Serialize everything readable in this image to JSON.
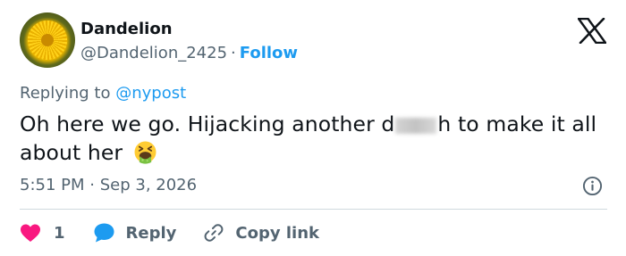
{
  "author": {
    "name": "Dandelion",
    "handle": "@Dandelion_2425",
    "separator": "·",
    "follow_label": "Follow",
    "avatar_icon": "dandelion-flower-avatar"
  },
  "platform_icon": "x-logo-icon",
  "reply": {
    "prefix": "Replying to",
    "mention": "@nypost"
  },
  "tweet": {
    "text_before": "Oh here we go. Hijacking another d",
    "text_after": "h to make it all about her",
    "censored_icon": "blurred-word",
    "emoji_icon": "face-vomiting-emoji"
  },
  "meta": {
    "time": "5:51 PM",
    "separator": "·",
    "date": "Sep 3, 2026"
  },
  "actions": {
    "like_count": "1",
    "reply_label": "Reply",
    "copy_label": "Copy link"
  },
  "colors": {
    "accent": "#1d9bf0",
    "like": "#f91880",
    "secondary_text": "#536471",
    "text": "#0f1419"
  }
}
